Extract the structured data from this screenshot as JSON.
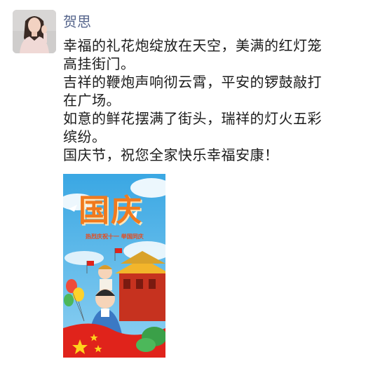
{
  "post": {
    "author": "贺思",
    "lines": [
      "幸福的礼花炮绽放在天空，美满的红灯笼",
      "高挂街门。",
      "吉祥的鞭炮声响彻云霄，平安的锣鼓敲打",
      "在广场。",
      "如意的鲜花摆满了街头，瑞祥的灯火五彩",
      "缤纷。",
      "国庆节，祝您全家快乐幸福安康！"
    ]
  },
  "image": {
    "title": "国庆",
    "subtitle": "热烈庆祝十一  举国同庆"
  },
  "colors": {
    "author_name": "#56658c",
    "text": "#1b1b1b",
    "sky": "#4fb4e6",
    "poster_title": "#f07a1e",
    "flag_red": "#e0231b",
    "star_yellow": "#ffd21c"
  }
}
